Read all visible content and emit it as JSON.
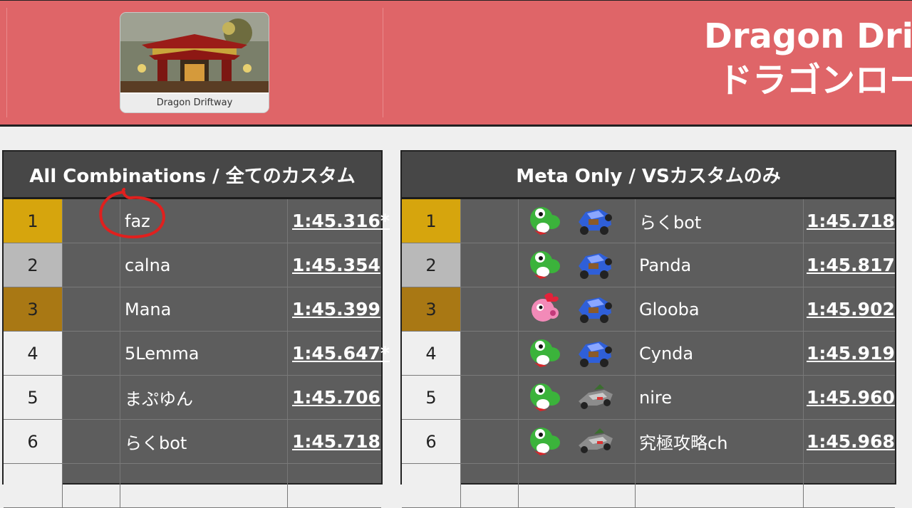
{
  "header": {
    "thumbnail_caption": "Dragon Driftway",
    "title_en": "Dragon Drift",
    "title_jp": "ドラゴンロー"
  },
  "panels": {
    "all": {
      "title": "All Combinations / 全てのカスタム",
      "rows": [
        {
          "rank": "1",
          "name": "faz",
          "time": "1:45.316*"
        },
        {
          "rank": "2",
          "name": "calna",
          "time": "1:45.354"
        },
        {
          "rank": "3",
          "name": "Mana",
          "time": "1:45.399"
        },
        {
          "rank": "4",
          "name": "5Lemma",
          "time": "1:45.647*"
        },
        {
          "rank": "5",
          "name": "まぷゆん",
          "time": "1:45.706"
        },
        {
          "rank": "6",
          "name": "らくbot",
          "time": "1:45.718"
        }
      ]
    },
    "meta": {
      "title": "Meta Only / VSカスタムのみ",
      "rows": [
        {
          "rank": "1",
          "character_icon": "yoshi-icon",
          "kart_icon": "blue-kart-icon",
          "name": "らくbot",
          "time": "1:45.718"
        },
        {
          "rank": "2",
          "character_icon": "yoshi-icon",
          "kart_icon": "blue-kart-icon",
          "name": "Panda",
          "time": "1:45.817"
        },
        {
          "rank": "3",
          "character_icon": "birdo-icon",
          "kart_icon": "blue-kart-icon",
          "name": "Glooba",
          "time": "1:45.902"
        },
        {
          "rank": "4",
          "character_icon": "yoshi-icon",
          "kart_icon": "blue-kart-icon",
          "name": "Cynda",
          "time": "1:45.919"
        },
        {
          "rank": "5",
          "character_icon": "yoshi-icon",
          "kart_icon": "gray-kart-icon",
          "name": "nire",
          "time": "1:45.960"
        },
        {
          "rank": "6",
          "character_icon": "yoshi-icon",
          "kart_icon": "gray-kart-icon",
          "name": "究極攻略ch",
          "time": "1:45.968"
        }
      ]
    }
  },
  "colors": {
    "banner": "#df6568",
    "gold": "#d6a50d",
    "silver": "#b9b9b9",
    "bronze": "#a97814",
    "annotation": "#e0201e"
  }
}
